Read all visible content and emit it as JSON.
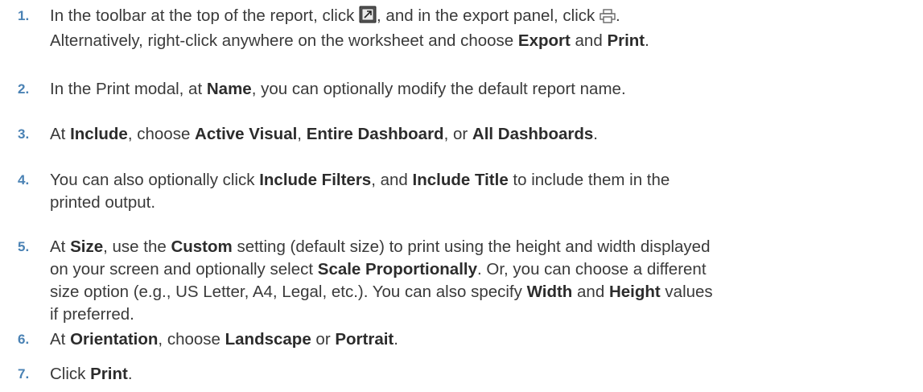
{
  "accent_color": "#4a82b4",
  "text_color": "#3a3a3a",
  "steps": [
    {
      "number": "1.",
      "parts": [
        {
          "t": "In the toolbar at the top of the report, click "
        },
        {
          "icon": "export-toolbar-icon"
        },
        {
          "t": ", and in the export panel, click "
        },
        {
          "icon": "print-icon"
        },
        {
          "t": "."
        },
        {
          "br": true
        },
        {
          "t": "Alternatively, right-click anywhere on the worksheet and choose "
        },
        {
          "b": "Export"
        },
        {
          "t": " and "
        },
        {
          "b": "Print"
        },
        {
          "t": "."
        }
      ]
    },
    {
      "number": "2.",
      "parts": [
        {
          "t": "In the Print modal, at "
        },
        {
          "b": "Name"
        },
        {
          "t": ", you can optionally modify the default report name."
        }
      ]
    },
    {
      "number": "3.",
      "parts": [
        {
          "t": "At "
        },
        {
          "b": "Include"
        },
        {
          "t": ", choose "
        },
        {
          "b": "Active Visual"
        },
        {
          "t": ", "
        },
        {
          "b": "Entire Dashboard"
        },
        {
          "t": ", or "
        },
        {
          "b": "All Dashboards"
        },
        {
          "t": "."
        }
      ]
    },
    {
      "number": "4.",
      "parts": [
        {
          "t": "You can also optionally click "
        },
        {
          "b": "Include Filters"
        },
        {
          "t": ", and "
        },
        {
          "b": "Include Title"
        },
        {
          "t": " to include them in the"
        },
        {
          "br": true
        },
        {
          "t": "printed output."
        }
      ]
    },
    {
      "number": "5.",
      "parts": [
        {
          "t": "At "
        },
        {
          "b": "Size"
        },
        {
          "t": ", use the "
        },
        {
          "b": "Custom"
        },
        {
          "t": " setting (default size) to print using the height and width displayed"
        },
        {
          "br": true
        },
        {
          "t": "on your screen and optionally select "
        },
        {
          "b": "Scale Proportionally"
        },
        {
          "t": ". Or, you can choose a different"
        },
        {
          "br": true
        },
        {
          "t": "size option (e.g., US Letter, A4, Legal, etc.). You can also specify "
        },
        {
          "b": "Width"
        },
        {
          "t": " and "
        },
        {
          "b": "Height"
        },
        {
          "t": " values"
        },
        {
          "br": true
        },
        {
          "t": "if preferred."
        }
      ]
    },
    {
      "number": "6.",
      "parts": [
        {
          "t": "At "
        },
        {
          "b": "Orientation"
        },
        {
          "t": ", choose "
        },
        {
          "b": "Landscape"
        },
        {
          "t": " or "
        },
        {
          "b": "Portrait"
        },
        {
          "t": "."
        }
      ]
    },
    {
      "number": "7.",
      "parts": [
        {
          "t": "Click "
        },
        {
          "b": "Print"
        },
        {
          "t": "."
        }
      ]
    }
  ]
}
